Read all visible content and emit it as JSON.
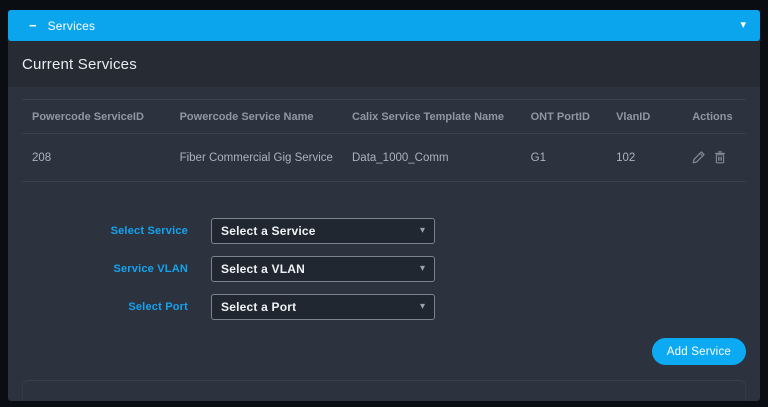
{
  "colors": {
    "accent": "#0ba5ee",
    "panel_bg": "#2d333e",
    "card_header_bg": "#262b34",
    "page_bg": "#0a0d12"
  },
  "accordion": {
    "collapse_glyph": "−",
    "title": "Services",
    "caret_glyph": "▾"
  },
  "card": {
    "title": "Current Services"
  },
  "table": {
    "columns": [
      "Powercode ServiceID",
      "Powercode Service Name",
      "Calix Service Template Name",
      "ONT PortID",
      "VlanID",
      "Actions"
    ],
    "rows": [
      {
        "powercode_service_id": "208",
        "powercode_service_name": "Fiber Commercial Gig Service",
        "calix_service_template_name": "Data_1000_Comm",
        "ont_port_id": "G1",
        "vlan_id": "102"
      }
    ]
  },
  "form": {
    "caret_glyph": "▾",
    "fields": [
      {
        "label": "Select Service",
        "value": "Select a Service"
      },
      {
        "label": "Service VLAN",
        "value": "Select a VLAN"
      },
      {
        "label": "Select Port",
        "value": "Select a Port"
      }
    ],
    "submit_label": "Add Service"
  }
}
